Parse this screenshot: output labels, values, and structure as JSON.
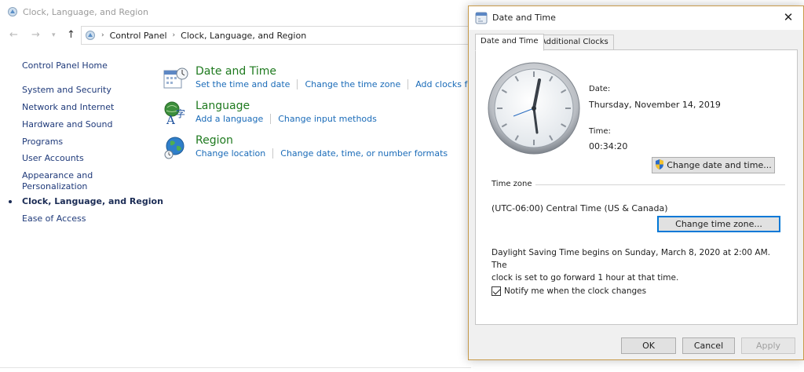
{
  "control_panel": {
    "window_title": "Clock, Language, and Region",
    "breadcrumb": [
      "Control Panel",
      "Clock, Language, and Region"
    ],
    "sidebar": {
      "home": "Control Panel Home",
      "items": [
        "System and Security",
        "Network and Internet",
        "Hardware and Sound",
        "Programs",
        "User Accounts",
        "Appearance and Personalization",
        "Clock, Language, and Region",
        "Ease of Access"
      ],
      "appearance_line1": "Appearance and",
      "appearance_line2": "Personalization"
    },
    "categories": {
      "datetime": {
        "title": "Date and Time",
        "links": [
          "Set the time and date",
          "Change the time zone",
          "Add clocks for di"
        ]
      },
      "language": {
        "title": "Language",
        "links": [
          "Add a language",
          "Change input methods"
        ]
      },
      "region": {
        "title": "Region",
        "links": [
          "Change location",
          "Change date, time, or number formats"
        ]
      }
    }
  },
  "dialog": {
    "title": "Date and Time",
    "close": "✕",
    "tabs": [
      "Date and Time",
      "Additional Clocks"
    ],
    "date_label": "Date:",
    "date_value": "Thursday, November 14, 2019",
    "time_label": "Time:",
    "time_value": "00:34:20",
    "change_datetime_button": "Change date and time...",
    "timezone_group": "Time zone",
    "timezone_value": "(UTC-06:00) Central Time (US & Canada)",
    "change_timezone_button": "Change time zone...",
    "dst_line1": "Daylight Saving Time begins on Sunday, March 8, 2020 at 2:00 AM. The",
    "dst_line2": "clock is set to go forward 1 hour at that time.",
    "notify_checkbox": "Notify me when the clock changes",
    "notify_checked": true,
    "buttons": {
      "ok": "OK",
      "cancel": "Cancel",
      "apply": "Apply"
    }
  }
}
